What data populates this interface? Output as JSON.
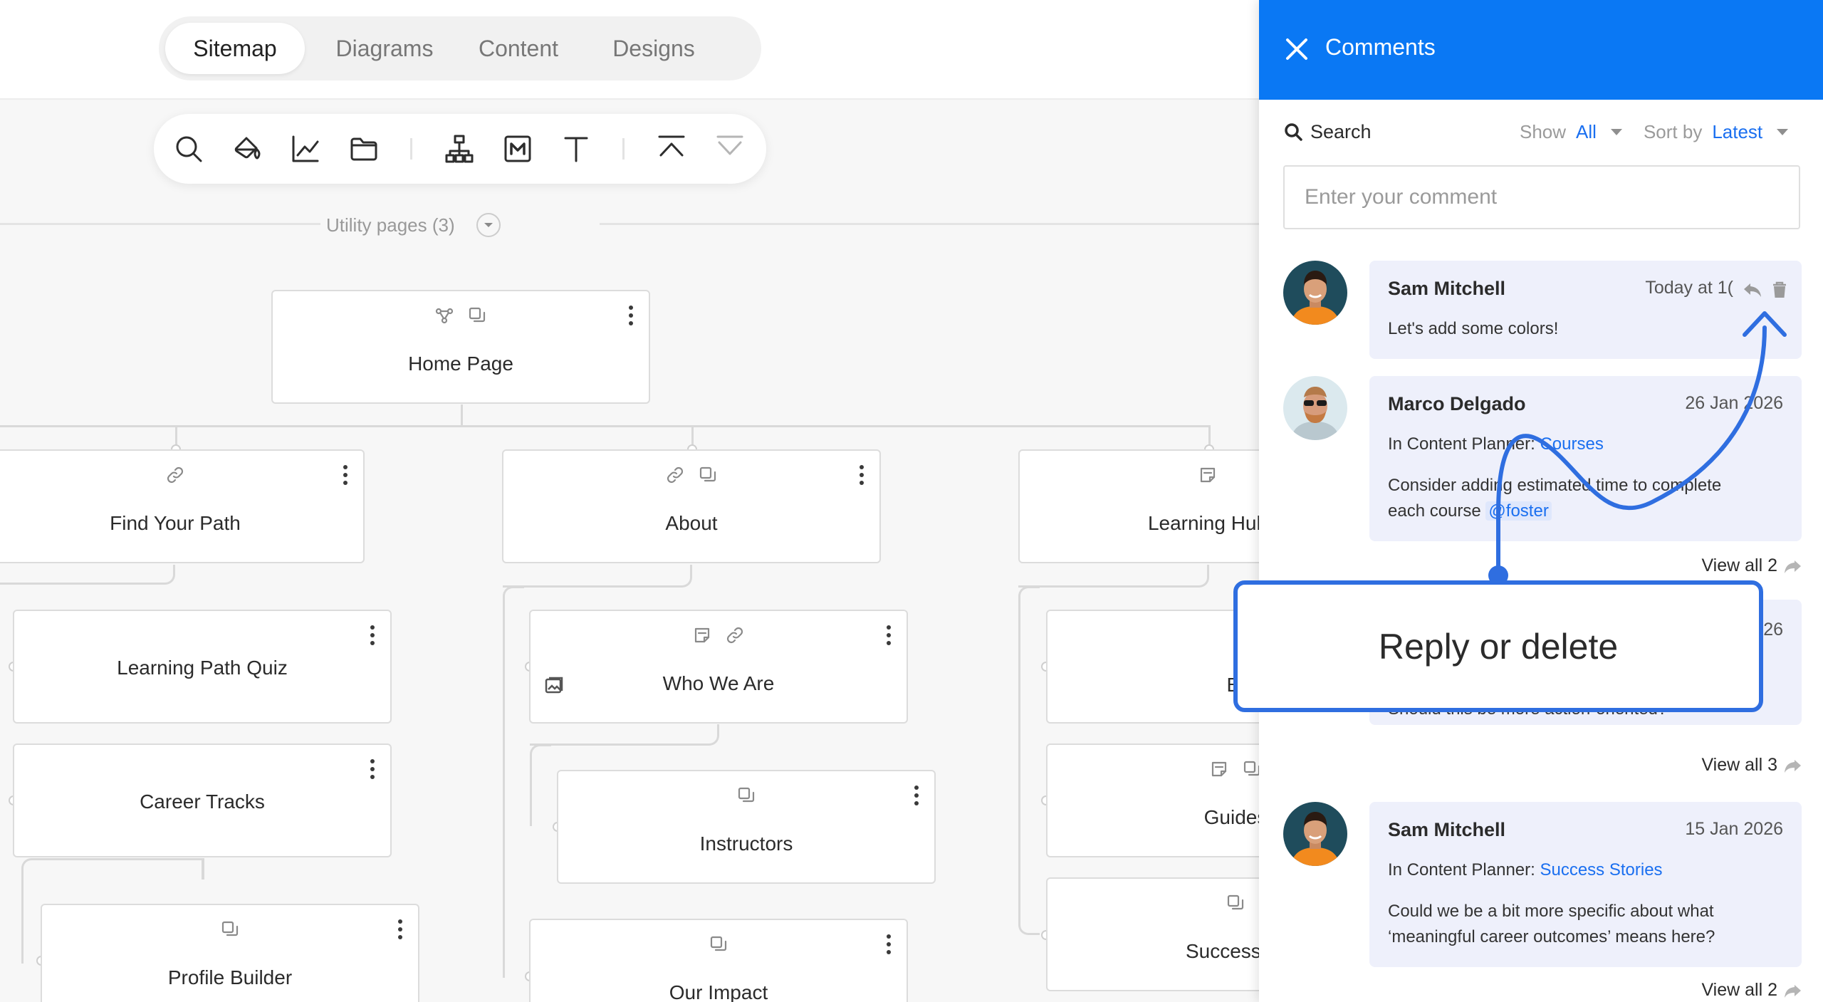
{
  "tabs": {
    "sitemap": "Sitemap",
    "diagrams": "Diagrams",
    "content": "Content",
    "designs": "Designs"
  },
  "toolbar": {
    "icons": [
      "search-icon",
      "paint-bucket-icon",
      "line-chart-icon",
      "folder-icon",
      "sitemap-icon",
      "markdown-icon",
      "text-icon",
      "collapse-up-icon",
      "collapse-down-icon"
    ]
  },
  "utility": {
    "label": "Utility pages (3)"
  },
  "nodes": {
    "home": "Home Page",
    "find_your_path": "Find Your Path",
    "about": "About",
    "learning_hub": "Learning Hub",
    "learning_path_quiz": "Learning Path Quiz",
    "career_tracks": "Career Tracks",
    "profile_builder": "Profile Builder",
    "who_we_are": "Who We Are",
    "instructors": "Instructors",
    "our_impact": "Our Impact",
    "blog": "Bl",
    "guides": "Guides",
    "success_stories": "Success St"
  },
  "panel": {
    "title": "Comments",
    "search_label": "Search",
    "show_label": "Show",
    "show_value": "All",
    "sort_label": "Sort by",
    "sort_value": "Latest",
    "input_placeholder": "Enter your comment",
    "accent": "#0a78f4"
  },
  "comments": [
    {
      "author": "Sam Mitchell",
      "date": "Today at 1(",
      "text": "Let's add some colors!"
    },
    {
      "author": "Marco Delgado",
      "date": "26 Jan 2026",
      "context_prefix": "In Content Planner: ",
      "context_link": "Courses",
      "text_line1": "Consider adding estimated time to complete",
      "text_line2": "each course",
      "mention": "@foster",
      "view_all": "View all 2"
    },
    {
      "date_partial": "26",
      "text_partial": "Should this be more action-oriented?",
      "view_all": "View all 3"
    },
    {
      "author": "Sam Mitchell",
      "date": "15 Jan 2026",
      "context_prefix": "In Content Planner: ",
      "context_link": "Success Stories",
      "text_line1": "Could we be a bit more specific about what",
      "text_line2": "‘meaningful career outcomes’ means here?",
      "view_all": "View all 2"
    }
  ],
  "callout": {
    "text": "Reply or delete",
    "color": "#2f6ee0"
  }
}
